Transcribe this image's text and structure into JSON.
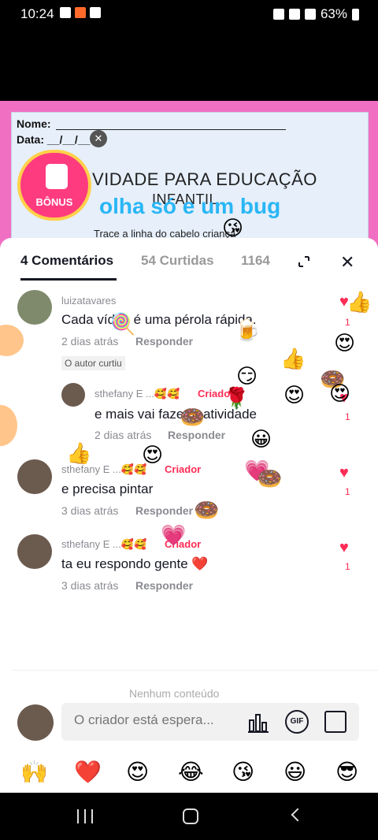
{
  "status_bar": {
    "time": "10:24",
    "battery": "63%"
  },
  "video": {
    "worksheet_name_label": "Nome:",
    "worksheet_date_label": "Data: __/__/__",
    "worksheet_title": "VIDADE PARA EDUCAÇÃO",
    "worksheet_title_line2": "INFANTIL",
    "worksheet_instruction": "Trace a linha do cabelo criança",
    "overlay_text": "olha só e um bug",
    "bonus_label": "BÔNUS"
  },
  "tabs": [
    {
      "label": "4 Comentários"
    },
    {
      "label": "54 Curtidas"
    },
    {
      "label": "1164"
    }
  ],
  "comments": [
    {
      "username": "luizatavares",
      "text": "Cada vídeo é uma pérola rápida.",
      "time": "2 dias atrás",
      "reply_label": "Responder",
      "liked_by_author": "O autor curtiu",
      "likes": "1"
    },
    {
      "username": "sthefany E ...🥰🥰",
      "creator_tag": "Criador",
      "text": "e mais vai fazer a atividade",
      "time": "2 dias atrás",
      "reply_label": "Responder",
      "likes": "1"
    },
    {
      "username": "sthefany E ...🥰🥰",
      "creator_tag": "Criador",
      "text": "e precisa pintar",
      "time": "3 dias atrás",
      "reply_label": "Responder",
      "likes": "1"
    },
    {
      "username": "sthefany E ...🥰🥰",
      "creator_tag": "Criador",
      "text": "ta eu respondo gente ❤️",
      "time": "3 dias atrás",
      "reply_label": "Responder",
      "likes": "1"
    }
  ],
  "no_content_text": "Nenhum conteúdo",
  "input": {
    "placeholder": "O criador está espera..."
  },
  "quick_emojis": [
    "🙌",
    "❤️",
    "😍",
    "😂",
    "😘",
    "😃",
    "😎"
  ],
  "colors": {
    "accent": "#fe2c55",
    "pink_frame": "#f06fc3"
  }
}
